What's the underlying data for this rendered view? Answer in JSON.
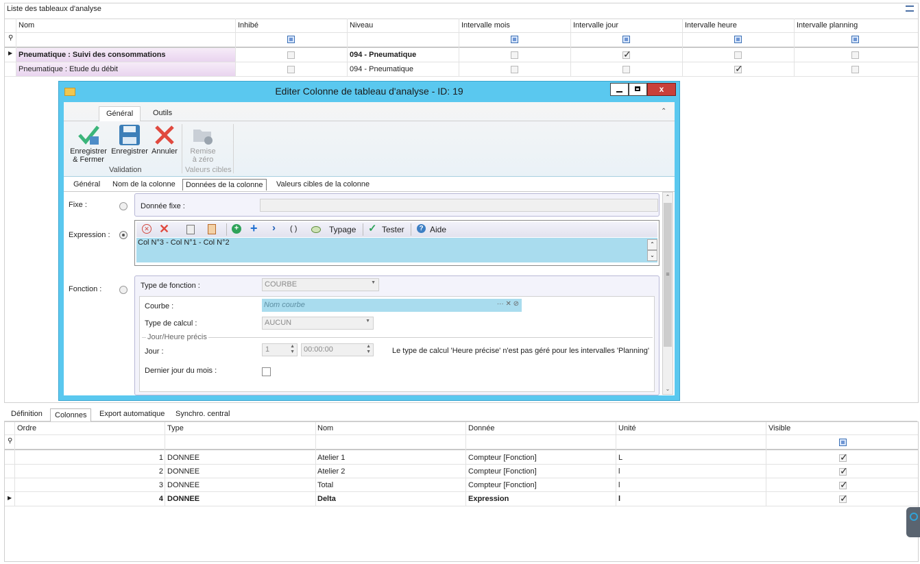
{
  "top_panel": {
    "title": "Liste des tableaux d'analyse",
    "columns": [
      "Nom",
      "Inhibé",
      "Niveau",
      "Intervalle mois",
      "Intervalle jour",
      "Intervalle heure",
      "Intervalle planning"
    ],
    "rows": [
      {
        "nom": "Pneumatique : Suivi des consommations",
        "niveau": "094 - Pneumatique",
        "inhibe": false,
        "mois": false,
        "jour": true,
        "heure": false,
        "planning": false,
        "selected": true
      },
      {
        "nom": "Pneumatique : Etude du débit",
        "niveau": "094 - Pneumatique",
        "inhibe": false,
        "mois": false,
        "jour": false,
        "heure": true,
        "planning": false,
        "selected": false
      }
    ]
  },
  "dialog": {
    "title": "Editer Colonne de tableau d'analyse - ID: 19",
    "ribbon_tabs": [
      "Général",
      "Outils"
    ],
    "ribbon_buttons": {
      "save_close": "Enregistrer\n& Fermer",
      "save": "Enregistrer",
      "cancel": "Annuler",
      "reset": "Remise\nà zéro"
    },
    "groups": {
      "validation": "Validation",
      "targets": "Valeurs cibles"
    },
    "page_tabs": [
      "Général",
      "Nom de la colonne",
      "Données de la colonne",
      "Valeurs cibles de la colonne"
    ],
    "fixe": {
      "label": "Fixe :",
      "field_label": "Donnée fixe :",
      "value": ""
    },
    "expression": {
      "label": "Expression :",
      "toolbar": {
        "typage": "Typage",
        "tester": "Tester",
        "aide": "Aide",
        "parens": "( )"
      },
      "value": "Col N°3  -  Col N°1  -  Col N°2"
    },
    "fonction": {
      "label": "Fonction :",
      "type_label": "Type de fonction :",
      "type_value": "COURBE",
      "courbe_label": "Courbe :",
      "courbe_placeholder": "Nom courbe",
      "calcul_label": "Type de calcul :",
      "calcul_value": "AUCUN",
      "group_title": "Jour/Heure précis",
      "jour_label": "Jour :",
      "jour_value": "1",
      "time_value": "00:00:00",
      "note": "Le type de calcul 'Heure précise' n'est pas géré pour les intervalles 'Planning'",
      "dernier_label": "Dernier jour du mois :"
    }
  },
  "bottom_panel": {
    "tabs": [
      "Définition",
      "Colonnes",
      "Export automatique",
      "Synchro. central"
    ],
    "active_tab": "Colonnes",
    "columns": [
      "Ordre",
      "Type",
      "Nom",
      "Donnée",
      "Unité",
      "Visible"
    ],
    "rows": [
      {
        "ordre": "1",
        "type": "DONNEE",
        "nom": "Atelier 1",
        "donnee": "Compteur [Fonction]",
        "unite": "L",
        "visible": true,
        "selected": false
      },
      {
        "ordre": "2",
        "type": "DONNEE",
        "nom": "Atelier 2",
        "donnee": "Compteur [Fonction]",
        "unite": "l",
        "visible": true,
        "selected": false
      },
      {
        "ordre": "3",
        "type": "DONNEE",
        "nom": "Total",
        "donnee": "Compteur [Fonction]",
        "unite": "l",
        "visible": true,
        "selected": false
      },
      {
        "ordre": "4",
        "type": "DONNEE",
        "nom": "Delta",
        "donnee": "Expression",
        "unite": "l",
        "visible": true,
        "selected": true
      }
    ]
  },
  "colors": {
    "dialog_frame": "#5ac8ef",
    "close_button": "#c9403a",
    "selected_row": "#f3e5f5",
    "expr_bg": "#a9dcee"
  }
}
